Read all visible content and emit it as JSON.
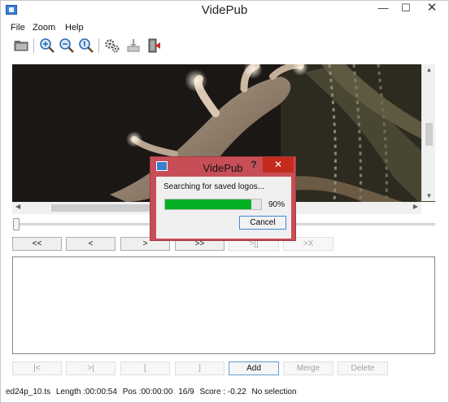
{
  "window": {
    "title": "VidePub",
    "minimize_glyph": "—",
    "maximize_glyph": "☐",
    "close_glyph": "✕"
  },
  "menu": [
    {
      "label": "File"
    },
    {
      "label": "Zoom"
    },
    {
      "label": "Help"
    }
  ],
  "toolbar": {
    "icons": [
      "open-folder-icon",
      "zoom-in-icon",
      "zoom-out-icon",
      "zoom-reset-icon",
      "settings-gears-icon",
      "export-icon",
      "exit-icon"
    ]
  },
  "nav_buttons": [
    {
      "label": "<<",
      "enabled": true
    },
    {
      "label": "<",
      "enabled": true
    },
    {
      "label": ">",
      "enabled": true
    },
    {
      "label": ">>",
      "enabled": true
    },
    {
      "label": ">[]",
      "enabled": false
    },
    {
      "label": ">X",
      "enabled": false
    }
  ],
  "edit_buttons": [
    {
      "label": "|<",
      "enabled": false
    },
    {
      "label": ">|",
      "enabled": false
    },
    {
      "label": "[",
      "enabled": false
    },
    {
      "label": "]",
      "enabled": false
    },
    {
      "label": "Add",
      "enabled": true
    },
    {
      "label": "Merge",
      "enabled": false
    },
    {
      "label": "Delete",
      "enabled": false
    }
  ],
  "status": {
    "file": "ed24p_10.ts",
    "length": "Length :00:00:54",
    "pos": "Pos :00:00:00",
    "aspect": "16/9",
    "score": "Score : -0.22",
    "selection": "No selection"
  },
  "dialog": {
    "title": "VidePub",
    "help_glyph": "?",
    "close_glyph": "✕",
    "message": "Searching for saved logos...",
    "progress": 0.9,
    "percent_label": "90%",
    "cancel_label": "Cancel"
  },
  "colors": {
    "dialog_frame": "#c74e57",
    "progress_fill": "#06b025",
    "close_red": "#c42b1c"
  }
}
